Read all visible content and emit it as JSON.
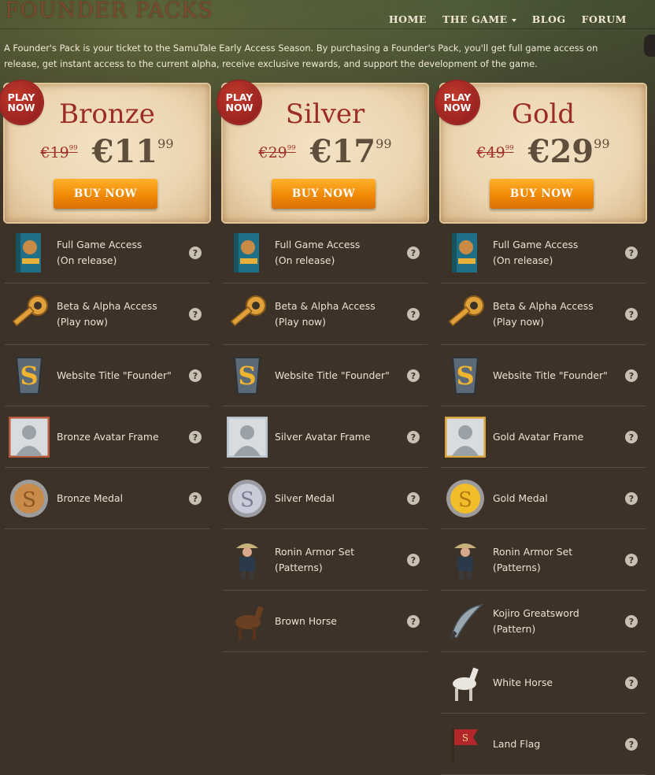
{
  "page_title": "FOUNDER PACKS",
  "nav": {
    "home": "HOME",
    "the_game": "THE GAME",
    "blog": "BLOG",
    "forum": "FORUM"
  },
  "intro": "A Founder's Pack is your ticket to the SamuTale Early Access Season. By purchasing a Founder's Pack, you'll get full game access on release, get instant access to the current alpha, receive exclusive rewards, and support the development of the game.",
  "badge": {
    "line1": "PLAY",
    "line2": "NOW"
  },
  "packs": [
    {
      "name": "Bronze",
      "old_int": "€19",
      "old_dec": "99",
      "new_int": "€11",
      "new_dec": "99",
      "buy": "BUY NOW",
      "items": [
        {
          "icon": "game-box",
          "l1": "Full Game Access",
          "l2": "(On release)"
        },
        {
          "icon": "key",
          "l1": "Beta & Alpha Access",
          "l2": "(Play now)"
        },
        {
          "icon": "s-emblem",
          "l1": "Website Title \"Founder\"",
          "l2": ""
        },
        {
          "icon": "avatar-frame-bronze",
          "l1": "Bronze Avatar Frame",
          "l2": ""
        },
        {
          "icon": "medal-bronze",
          "l1": "Bronze Medal",
          "l2": ""
        }
      ]
    },
    {
      "name": "Silver",
      "old_int": "€29",
      "old_dec": "99",
      "new_int": "€17",
      "new_dec": "99",
      "buy": "BUY NOW",
      "items": [
        {
          "icon": "game-box",
          "l1": "Full Game Access",
          "l2": "(On release)"
        },
        {
          "icon": "key",
          "l1": "Beta & Alpha Access",
          "l2": "(Play now)"
        },
        {
          "icon": "s-emblem",
          "l1": "Website Title \"Founder\"",
          "l2": ""
        },
        {
          "icon": "avatar-frame-silver",
          "l1": "Silver Avatar Frame",
          "l2": ""
        },
        {
          "icon": "medal-silver",
          "l1": "Silver Medal",
          "l2": ""
        },
        {
          "icon": "ronin-armor",
          "l1": "Ronin Armor Set",
          "l2": "(Patterns)"
        },
        {
          "icon": "brown-horse",
          "l1": "Brown Horse",
          "l2": ""
        }
      ]
    },
    {
      "name": "Gold",
      "old_int": "€49",
      "old_dec": "99",
      "new_int": "€29",
      "new_dec": "99",
      "buy": "BUY NOW",
      "items": [
        {
          "icon": "game-box",
          "l1": "Full Game Access",
          "l2": "(On release)"
        },
        {
          "icon": "key",
          "l1": "Beta & Alpha Access",
          "l2": "(Play now)"
        },
        {
          "icon": "s-emblem",
          "l1": "Website Title \"Founder\"",
          "l2": ""
        },
        {
          "icon": "avatar-frame-gold",
          "l1": "Gold Avatar Frame",
          "l2": ""
        },
        {
          "icon": "medal-gold",
          "l1": "Gold Medal",
          "l2": ""
        },
        {
          "icon": "ronin-armor",
          "l1": "Ronin Armor Set",
          "l2": "(Patterns)"
        },
        {
          "icon": "greatsword",
          "l1": "Kojiro Greatsword",
          "l2": "(Pattern)"
        },
        {
          "icon": "white-horse",
          "l1": "White Horse",
          "l2": ""
        },
        {
          "icon": "land-flag",
          "l1": "Land Flag",
          "l2": ""
        }
      ]
    }
  ],
  "help_glyph": "?"
}
